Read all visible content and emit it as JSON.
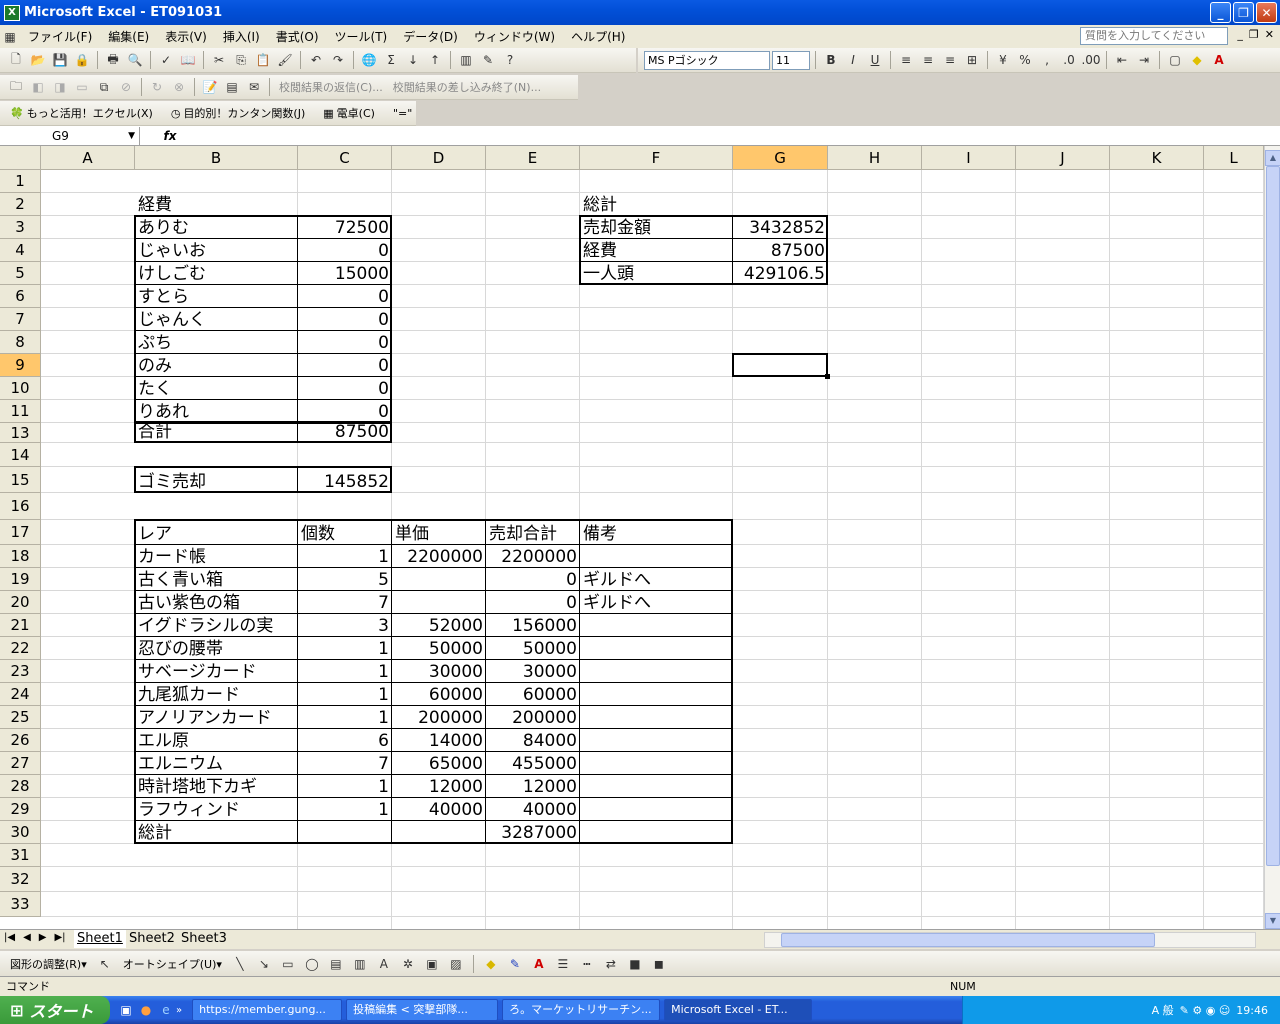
{
  "window": {
    "title": "Microsoft Excel - ET091031",
    "app_icon": "X"
  },
  "menu": [
    "ファイル(F)",
    "編集(E)",
    "表示(V)",
    "挿入(I)",
    "書式(O)",
    "ツール(T)",
    "データ(D)",
    "ウィンドウ(W)",
    "ヘルプ(H)"
  ],
  "help_box": {
    "placeholder": "質問を入力してください"
  },
  "format_bar": {
    "font": "MS Pゴシック",
    "size": "11"
  },
  "review_bar": {
    "reply": "校閲結果の返信(C)...",
    "end": "校閲結果の差し込み終了(N)..."
  },
  "custom_bar": {
    "item1": "もっと活用！エクセル(X)",
    "item2": "目的別！カンタン関数(J)",
    "item3": "電卓(C)",
    "item4": "\"=\""
  },
  "formula": {
    "namebox": "G9",
    "fx": "fx",
    "content": ""
  },
  "columns": [
    "A",
    "B",
    "C",
    "D",
    "E",
    "F",
    "G",
    "H",
    "I",
    "J",
    "K",
    "L"
  ],
  "selected_cell": {
    "col": "G",
    "row": 9
  },
  "rows": [
    "1",
    "2",
    "3",
    "4",
    "5",
    "6",
    "7",
    "8",
    "9",
    "10",
    "11",
    "13",
    "14",
    "15",
    "16",
    "17",
    "18",
    "19",
    "20",
    "21",
    "22",
    "23",
    "24",
    "25",
    "26",
    "27",
    "28",
    "29",
    "30",
    "31",
    "32",
    "33"
  ],
  "expenses": {
    "title": "経費",
    "items": [
      {
        "name": "ありむ",
        "value": "72500"
      },
      {
        "name": "じゃいお",
        "value": "0"
      },
      {
        "name": "けしごむ",
        "value": "15000"
      },
      {
        "name": "すとら",
        "value": "0"
      },
      {
        "name": "じゃんく",
        "value": "0"
      },
      {
        "name": "ぷち",
        "value": "0"
      },
      {
        "name": "のみ",
        "value": "0"
      },
      {
        "name": "たく",
        "value": "0"
      },
      {
        "name": "りあれ",
        "value": "0"
      }
    ],
    "total_label": "合計",
    "total_value": "87500",
    "trash_label": "ゴミ売却",
    "trash_value": "145852"
  },
  "summary": {
    "title": "総計",
    "rows": [
      {
        "label": "売却金額",
        "value": "3432852"
      },
      {
        "label": "経費",
        "value": "87500"
      },
      {
        "label": "一人頭",
        "value": "429106.5"
      }
    ]
  },
  "rare": {
    "headers": [
      "レア",
      "個数",
      "単価",
      "売却合計",
      "備考"
    ],
    "rows": [
      [
        "カード帳",
        "1",
        "2200000",
        "2200000",
        ""
      ],
      [
        "古く青い箱",
        "5",
        "",
        "0",
        "ギルドへ"
      ],
      [
        "古い紫色の箱",
        "7",
        "",
        "0",
        "ギルドへ"
      ],
      [
        "イグドラシルの実",
        "3",
        "52000",
        "156000",
        ""
      ],
      [
        "忍びの腰帯",
        "1",
        "50000",
        "50000",
        ""
      ],
      [
        "サベージカード",
        "1",
        "30000",
        "30000",
        ""
      ],
      [
        "九尾狐カード",
        "1",
        "60000",
        "60000",
        ""
      ],
      [
        "アノリアンカード",
        "1",
        "200000",
        "200000",
        ""
      ],
      [
        "エル原",
        "6",
        "14000",
        "84000",
        ""
      ],
      [
        "エルニウム",
        "7",
        "65000",
        "455000",
        ""
      ],
      [
        "時計塔地下カギ",
        "1",
        "12000",
        "12000",
        ""
      ],
      [
        "ラフウィンド",
        "1",
        "40000",
        "40000",
        ""
      ]
    ],
    "total_label": "総計",
    "total_value": "3287000"
  },
  "sheets": [
    "Sheet1",
    "Sheet2",
    "Sheet3"
  ],
  "draw_bar": {
    "adjust": "図形の調整(R)▾",
    "autoshape": "オートシェイプ(U)▾"
  },
  "status": {
    "mode": "コマンド",
    "num": "NUM"
  },
  "taskbar": {
    "start": "スタート",
    "tasks": [
      "https://member.gung...",
      "投稿編集 < 突撃部隊...",
      "ろ。マーケットリサーチン...",
      "Microsoft Excel - ET..."
    ],
    "clock": "19:46",
    "ime": "A 般"
  }
}
